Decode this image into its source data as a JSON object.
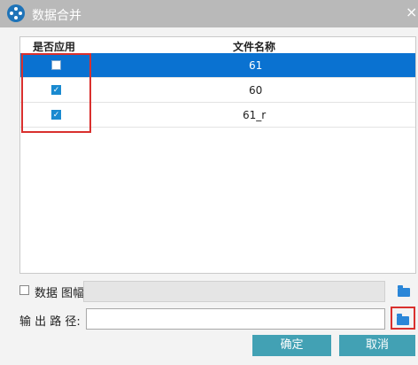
{
  "window": {
    "title": "数据合并",
    "close_symbol": "×"
  },
  "table": {
    "columns": [
      "是否应用",
      "文件名称"
    ],
    "rows": [
      {
        "checked": false,
        "name": "61",
        "selected": true
      },
      {
        "checked": true,
        "name": "60",
        "selected": false
      },
      {
        "checked": true,
        "name": "61_r",
        "selected": false
      }
    ]
  },
  "options": {
    "data_image_label": "数据 图幅",
    "data_image_checked": false
  },
  "output": {
    "label": "输 出 路 径:",
    "path_value": ""
  },
  "buttons": {
    "ok": "确定",
    "cancel": "取消"
  },
  "colors": {
    "titlebar": "#b9b9b9",
    "selected_row": "#0a72d1",
    "button": "#42a1b4",
    "highlight": "#d9302e",
    "folder": "#2a86d8"
  },
  "icons": {
    "app": "app-logo-icon",
    "folder": "folder-open-icon",
    "check": "checkmark-icon"
  }
}
